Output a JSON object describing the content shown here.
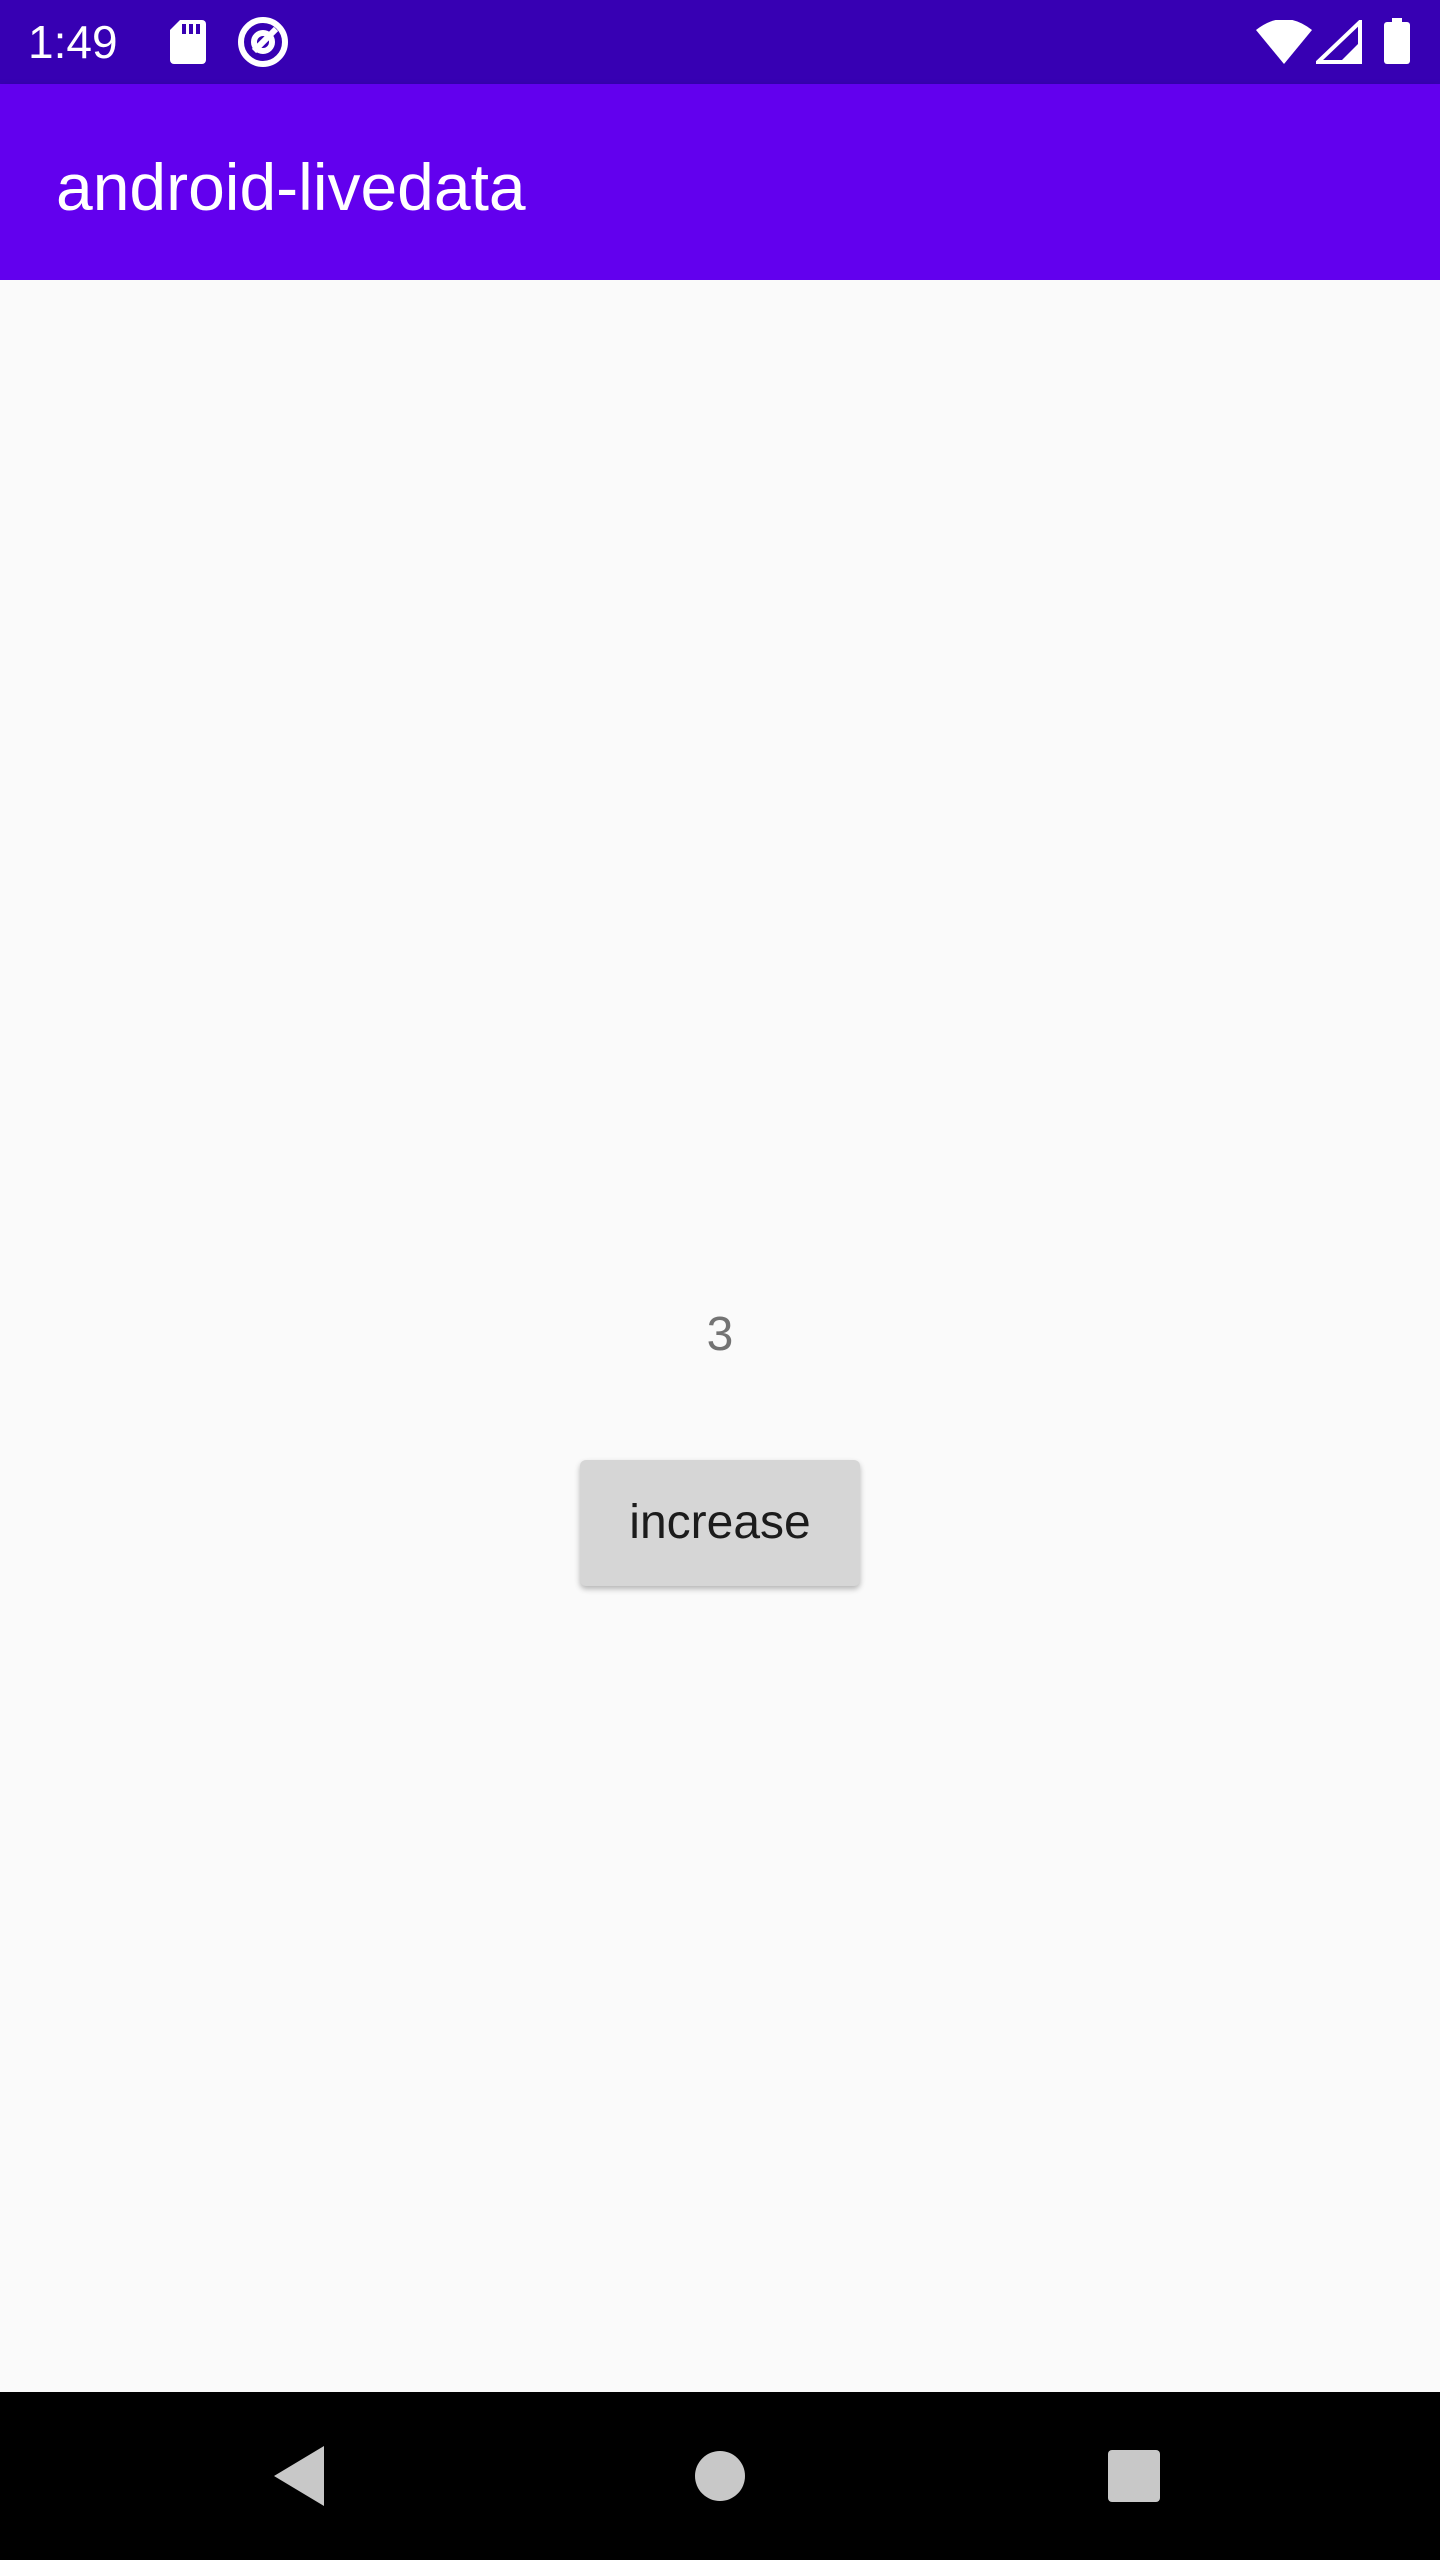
{
  "status_bar": {
    "time": "1:49",
    "background": "#3700b3",
    "icons_left": [
      "sd-card-icon",
      "at-sign-icon"
    ],
    "icons_right": [
      "wifi-icon",
      "cell-signal-icon",
      "battery-icon"
    ]
  },
  "app_bar": {
    "title": "android-livedata",
    "background": "#6200ee"
  },
  "main": {
    "counter_value": "3",
    "increase_button_label": "increase"
  },
  "nav_bar": {
    "buttons": [
      "back-icon",
      "home-icon",
      "recents-icon"
    ]
  }
}
